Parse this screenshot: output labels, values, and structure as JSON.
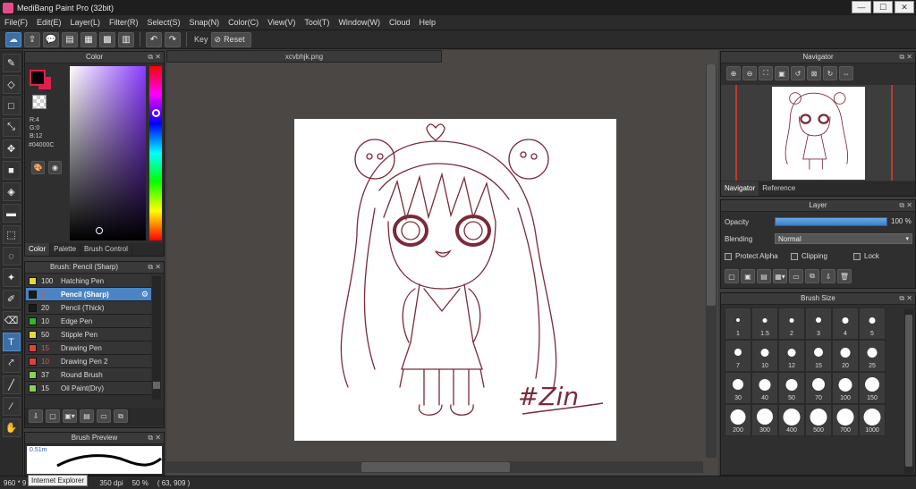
{
  "window": {
    "title": "MediBang Paint Pro (32bit)",
    "min": "—",
    "max": "☐",
    "close": "✕"
  },
  "menu": [
    "File(F)",
    "Edit(E)",
    "Layer(L)",
    "Filter(R)",
    "Select(S)",
    "Snap(N)",
    "Color(C)",
    "View(V)",
    "Tool(T)",
    "Window(W)",
    "Cloud",
    "Help"
  ],
  "toolbar": {
    "key_label": "Key",
    "reset_label": "Reset"
  },
  "color_panel": {
    "title": "Color",
    "r": "R:4",
    "g": "G:0",
    "b": "B:12",
    "hex": "#04000C",
    "tabs": [
      "Color",
      "Palette",
      "Brush Control"
    ],
    "fg_color": "#04000C",
    "bg_color": "#e0204a"
  },
  "brush_panel": {
    "title": "Brush: Pencil (Sharp)",
    "items": [
      {
        "size": "100",
        "name": "Hatching Pen",
        "color": "#e8d83a"
      },
      {
        "size": "7",
        "name": "Pencil (Sharp)",
        "color": "#1a1a1a"
      },
      {
        "size": "20",
        "name": "Pencil (Thick)",
        "color": "#1a1a1a"
      },
      {
        "size": "10",
        "name": "Edge Pen",
        "color": "#2fb82f"
      },
      {
        "size": "50",
        "name": "Stipple Pen",
        "color": "#e8d83a"
      },
      {
        "size": "15",
        "name": "Drawing Pen",
        "color": "#e04040"
      },
      {
        "size": "10",
        "name": "Drawing Pen 2",
        "color": "#e04040"
      },
      {
        "size": "37",
        "name": "Round Brush",
        "color": "#8ad14a"
      },
      {
        "size": "15",
        "name": "Oil Paint(Dry)",
        "color": "#8ad14a"
      }
    ]
  },
  "brush_preview": {
    "title": "Brush Preview",
    "size": "0.51m"
  },
  "document": {
    "tab_name": "xcvbhjk.png"
  },
  "navigator": {
    "title": "Navigator",
    "tabs": [
      "Navigator",
      "Reference"
    ]
  },
  "layer": {
    "title": "Layer",
    "opacity_label": "Opacity",
    "opacity_value": "100 %",
    "opacity": 100,
    "blending_label": "Blending",
    "blending_value": "Normal",
    "protect_alpha": "Protect Alpha",
    "clipping": "Clipping",
    "lock": "Lock"
  },
  "brush_size": {
    "title": "Brush Size",
    "sizes": [
      "1",
      "1.5",
      "2",
      "3",
      "4",
      "5",
      "7",
      "10",
      "12",
      "15",
      "20",
      "25",
      "30",
      "40",
      "50",
      "70",
      "100",
      "150",
      "200",
      "300",
      "400",
      "500",
      "700",
      "1000"
    ]
  },
  "status": {
    "dims": "960 * 9",
    "tooltip": "Internet Explorer",
    "dpi": "350 dpi",
    "zoom": "50 %",
    "coords": "( 63, 909 )"
  },
  "artwork": {
    "signature": "#Zin",
    "line_color": "#7a2a3a"
  }
}
